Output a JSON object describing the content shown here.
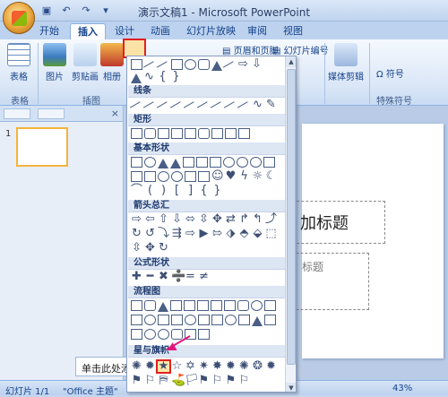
{
  "window": {
    "title": "演示文稿1 - Microsoft PowerPoint"
  },
  "tabs": [
    "开始",
    "插入",
    "设计",
    "动画",
    "幻灯片放映",
    "审阅",
    "视图"
  ],
  "ribbon": {
    "buttons": [
      "表格",
      "图片",
      "剪贴画",
      "相册"
    ],
    "groups": [
      "表格",
      "插图",
      "特殊符号"
    ],
    "header_footer": "页眉和页脚",
    "slide_number": "幻灯片编号",
    "media": "媒体剪辑",
    "symbol": "符号"
  },
  "dropdown": {
    "sections": [
      "线条",
      "矩形",
      "基本形状",
      "箭头总汇",
      "公式形状",
      "流程图",
      "星与旗帜"
    ]
  },
  "slide": {
    "title_placeholder": "单击此处添加标题",
    "title_visible": "加标题",
    "subtitle_visible": "标题",
    "notes_text": "单击此处添"
  },
  "status": {
    "slide_info": "幻灯片 1/1",
    "theme": "\"Office 主题\"",
    "zoom_value": "43%"
  }
}
